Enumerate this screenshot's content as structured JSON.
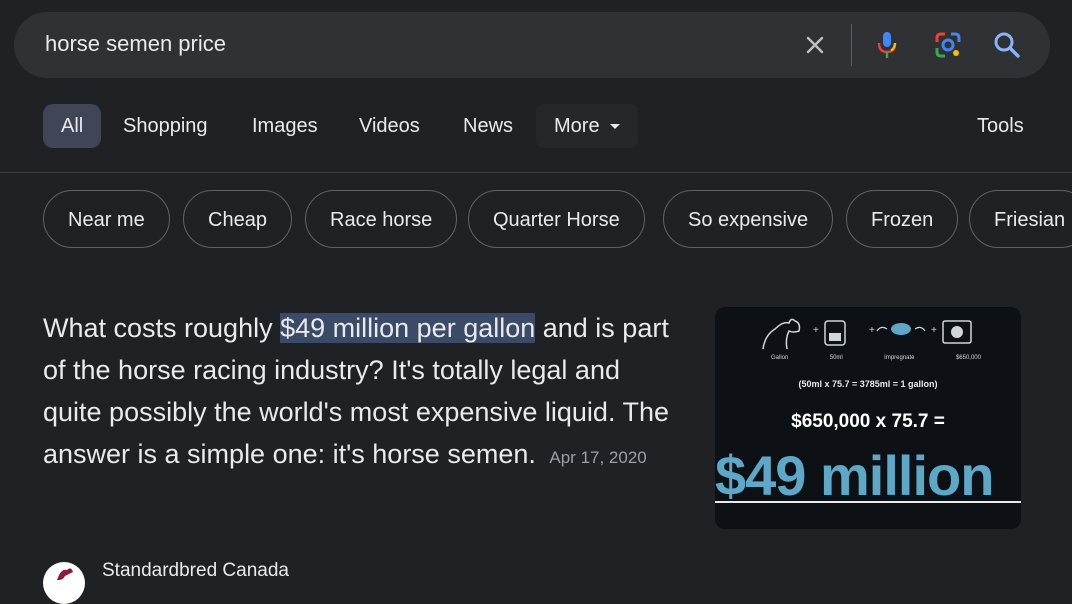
{
  "search": {
    "query": "horse semen price"
  },
  "icons": {
    "clear": "close-icon",
    "mic": "mic-icon",
    "lens": "camera-lens-icon",
    "search": "search-icon"
  },
  "tabs": [
    "All",
    "Shopping",
    "Images",
    "Videos",
    "News",
    "More"
  ],
  "tools_label": "Tools",
  "chips": [
    "Near me",
    "Cheap",
    "Race horse",
    "Quarter Horse",
    "So expensive",
    "Frozen",
    "Friesian"
  ],
  "snippet": {
    "before": "What costs roughly ",
    "highlight": "$49 million per gallon",
    "after": " and is part of the horse racing industry? It's totally legal and quite possibly the world's most expensive liquid. The answer is a simple one: it's horse semen.",
    "date": "Apr 17, 2020"
  },
  "image": {
    "labels": [
      "Gallon",
      "50ml",
      "Impregnate",
      "$650,000"
    ],
    "calc": "(50ml x 75.7 = 3785ml = 1 gallon)",
    "equation": "$650,000 x 75.7 =",
    "result": "$49 million"
  },
  "source": {
    "name": "Standardbred Canada"
  },
  "colors": {
    "background": "#202124",
    "searchbar": "#303134",
    "active_tab": "#414656",
    "highlight": "#3b4a66",
    "accent_blue": "#5ea7c7"
  }
}
